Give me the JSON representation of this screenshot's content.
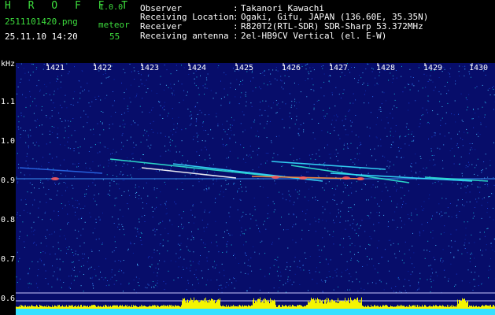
{
  "header": {
    "app_title": "H R O F F T",
    "app_version": "1.0.0",
    "file_name": "2511101420.png",
    "datetime": "25.11.10 14:20",
    "meteor_label": "meteor",
    "meteor_count": "55"
  },
  "info": [
    {
      "key": "Observer",
      "value": "Takanori Kawachi"
    },
    {
      "key": "Receiving Location",
      "value": "Ogaki, Gifu, JAPAN (136.60E, 35.35N)"
    },
    {
      "key": "Receiver",
      "value": "R820T2(RTL-SDR) SDR-Sharp 53.372MHz"
    },
    {
      "key": "Receiving antenna",
      "value": "2el-HB9CV Vertical (el. E-W)"
    }
  ],
  "info_separator": ":",
  "y_axis": {
    "unit": "kHz",
    "ticks": [
      "1.1",
      "1.0",
      "0.9",
      "0.8",
      "0.7",
      "0.6"
    ]
  },
  "x_axis": {
    "ticks": [
      "1421",
      "1422",
      "1423",
      "1424",
      "1425",
      "1426",
      "1427",
      "1428",
      "1429",
      "1430"
    ]
  },
  "colors": {
    "label_green": "#3ddc3d",
    "spectrogram_bg": "#070d6a",
    "signal_bar": "#f5f500",
    "baseline": "#36e0ff"
  }
}
